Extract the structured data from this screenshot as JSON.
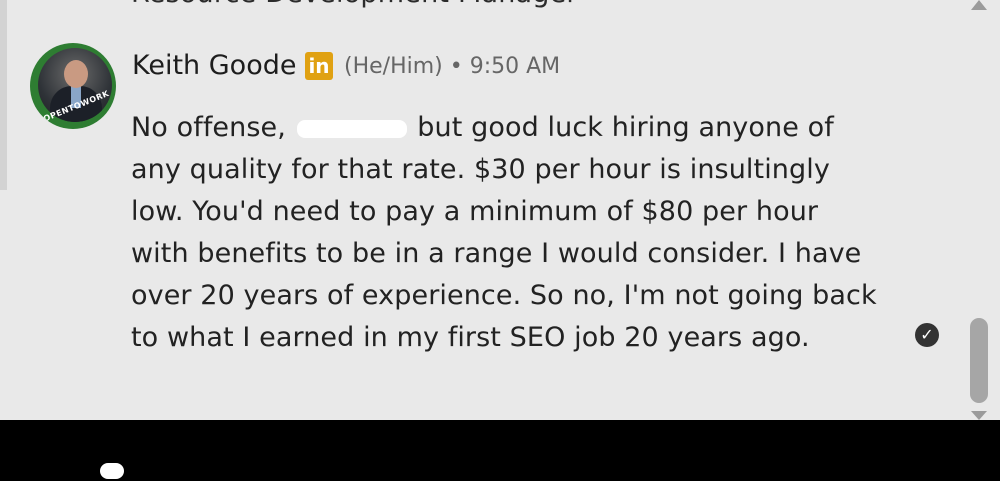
{
  "previous_message": {
    "text": "Resource Development Manager"
  },
  "comment": {
    "author": "Keith Goode",
    "network_logo": "in",
    "pronouns": "(He/Him)",
    "separator": "•",
    "time": "9:50 AM",
    "avatar_badge": "#OPENTOWORK",
    "lines": [
      {
        "before": "No offense,",
        "after": "but good luck hiring anyone of"
      },
      "any quality for that rate. $30 per hour is insultingly",
      "low. You'd need to pay a minimum of $80 per hour",
      "with benefits to be in a range I would consider. I have",
      "over 20 years of experience. So no, I'm not going back",
      "to what I earned in my first SEO job 20 years ago."
    ]
  },
  "icons": {
    "read_receipt": "check-circle-icon"
  },
  "colors": {
    "badge_green": "#2e7d32",
    "logo_gold": "#e0a112"
  }
}
